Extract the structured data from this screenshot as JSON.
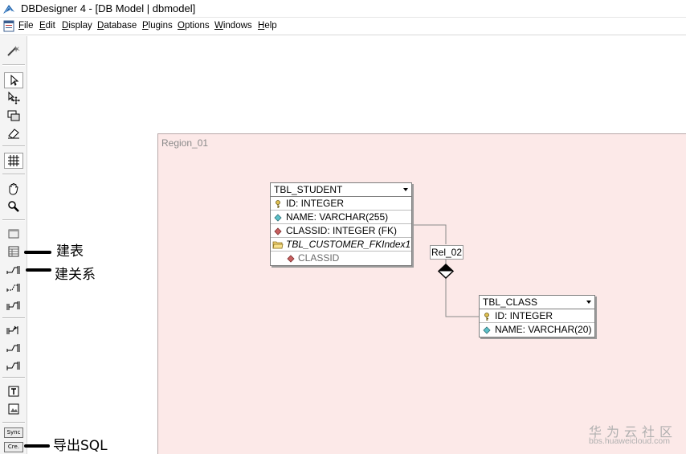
{
  "window": {
    "title": "DBDesigner 4 - [DB Model | dbmodel]"
  },
  "menu": [
    {
      "label": "File",
      "key": "F"
    },
    {
      "label": "Edit",
      "key": "E"
    },
    {
      "label": "Display",
      "key": "D"
    },
    {
      "label": "Database",
      "key": "D"
    },
    {
      "label": "Plugins",
      "key": "P"
    },
    {
      "label": "Options",
      "key": "O"
    },
    {
      "label": "Windows",
      "key": "W"
    },
    {
      "label": "Help",
      "key": "H"
    }
  ],
  "toolbar": {
    "sync_label": "Sync",
    "create_label": "Cre.",
    "icons": [
      "wand-icon",
      "pointer-icon",
      "move-icon",
      "sizing-icon",
      "eraser-icon",
      "grid-icon",
      "hand-icon",
      "magnifier-icon",
      "region-icon",
      "new-table-icon",
      "relation-1n-icon",
      "relation-11-icon",
      "relation-nm-icon",
      "relation-1n-sub-icon",
      "relation-11-sub-icon",
      "relation-nm-sub-icon",
      "text-note-icon",
      "image-icon"
    ]
  },
  "canvas": {
    "region": {
      "label": "Region_01",
      "color": "#fce9e8"
    },
    "tables": [
      {
        "name": "TBL_STUDENT",
        "rows": [
          {
            "text": "ID: INTEGER",
            "icon": "key-icon"
          },
          {
            "text": "NAME: VARCHAR(255)",
            "icon": "diamond-cyan-icon"
          },
          {
            "text": "CLASSID: INTEGER (FK)",
            "icon": "diamond-red-icon"
          },
          {
            "text": "TBL_CUSTOMER_FKIndex1",
            "icon": "folder-icon",
            "index": true
          },
          {
            "text": "CLASSID",
            "icon": "diamond-red-icon",
            "sub": true
          }
        ]
      },
      {
        "name": "TBL_CLASS",
        "rows": [
          {
            "text": "ID: INTEGER",
            "icon": "key-icon"
          },
          {
            "text": "NAME: VARCHAR(20)",
            "icon": "diamond-cyan-icon"
          }
        ]
      }
    ],
    "relation": {
      "label": "Rel_02"
    }
  },
  "annotations": {
    "create_table": "建表",
    "create_relation": "建关系",
    "export_sql": "导出SQL"
  },
  "watermark": {
    "brand": "华为云社区",
    "url": "bbs.huaweicloud.com"
  }
}
